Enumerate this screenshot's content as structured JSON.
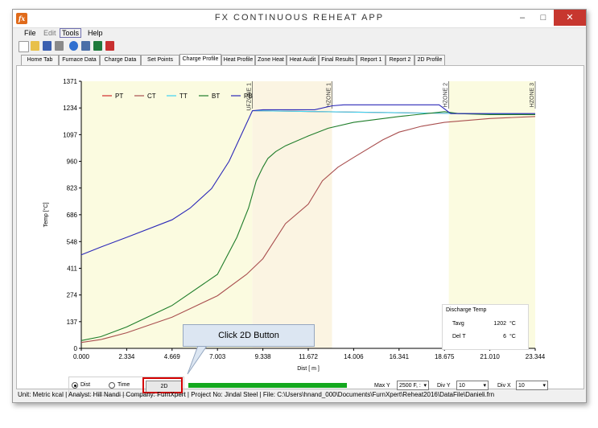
{
  "window": {
    "title": "FX CONTINUOUS REHEAT APP",
    "icon_label": "fx",
    "controls": {
      "minimize": "–",
      "maximize": "□",
      "close": "✕"
    }
  },
  "menu": [
    "File",
    "Edit",
    "Tools",
    "Help"
  ],
  "toolbar_icons": [
    "new-file-icon",
    "open-folder-icon",
    "save-icon",
    "print-icon",
    "help-icon",
    "report-icon",
    "excel-icon",
    "pdf-icon"
  ],
  "tabs": [
    "Home Tab",
    "Furnace Data",
    "Charge Data",
    "Set Points",
    "Charge Profile",
    "Heat Profile",
    "Zone Heat",
    "Heat Audit",
    "Final Results",
    "Report 1",
    "Report 2",
    "2D Profile"
  ],
  "active_tab": "Charge Profile",
  "chart_data": {
    "type": "line",
    "xlabel": "Dist [ m ]",
    "ylabel": "Temp [°C]",
    "x_ticks": [
      "0.000",
      "2.334",
      "4.669",
      "7.003",
      "9.338",
      "11.672",
      "14.006",
      "16.341",
      "18.675",
      "21.010",
      "23.344"
    ],
    "y_ticks": [
      "0",
      "137",
      "274",
      "411",
      "548",
      "686",
      "823",
      "960",
      "1097",
      "1234",
      "1371"
    ],
    "xlim": [
      0,
      23.344
    ],
    "ylim": [
      0,
      1371
    ],
    "grid": false,
    "legend_position": "top-left",
    "zones": [
      {
        "label": "UFZONE 1",
        "x_start": 0.0,
        "x_end": 8.8,
        "color": "#fbfbe0"
      },
      {
        "label": "HZONE 1",
        "x_start": 8.8,
        "x_end": 12.9,
        "color": "#fbf4e2"
      },
      {
        "label": "HZONE 2",
        "x_start": 12.9,
        "x_end": 18.9,
        "color": "#ffffff"
      },
      {
        "label": "HZONE 3",
        "x_start": 18.9,
        "x_end": 23.344,
        "color": "#fbfbe0"
      }
    ],
    "zone_label_x": [
      8.8,
      12.9,
      18.9,
      23.344
    ],
    "series": [
      {
        "name": "PT",
        "color": "#d22b2b",
        "x": [
          8.8,
          23.344
        ],
        "y": [
          1220,
          1200
        ]
      },
      {
        "name": "CT",
        "color": "#a94f4f",
        "x": [
          0,
          1,
          2.334,
          4.669,
          7.003,
          8.5,
          9.338,
          10.5,
          11.672,
          12.4,
          13.2,
          14.006,
          15.5,
          16.341,
          17.5,
          18.675,
          21.01,
          23.344
        ],
        "y": [
          30,
          45,
          80,
          160,
          270,
          380,
          460,
          640,
          740,
          860,
          930,
          980,
          1070,
          1110,
          1140,
          1160,
          1180,
          1190
        ]
      },
      {
        "name": "TT",
        "color": "#3ed2f0",
        "x": [
          8.8,
          23.344
        ],
        "y": [
          1220,
          1200
        ]
      },
      {
        "name": "BT",
        "color": "#1f7d2a",
        "x": [
          0,
          1,
          2.334,
          4.669,
          7.003,
          8.0,
          8.6,
          9.0,
          9.338,
          9.6,
          10.0,
          10.5,
          11.672,
          12.7,
          14.006,
          16.341,
          18.675,
          19.4,
          21.01,
          23.344
        ],
        "y": [
          40,
          60,
          110,
          220,
          380,
          570,
          720,
          860,
          930,
          975,
          1010,
          1040,
          1090,
          1130,
          1160,
          1190,
          1215,
          1205,
          1200,
          1200
        ]
      },
      {
        "name": "PB",
        "color": "#2b28b8",
        "x": [
          0,
          1,
          2.334,
          4.669,
          5.6,
          6.7,
          7.6,
          8.8,
          9.338,
          12.0,
          12.9,
          13.5,
          18.4,
          19.0,
          19.4,
          21.01,
          23.344
        ],
        "y": [
          480,
          520,
          570,
          660,
          720,
          820,
          960,
          1220,
          1225,
          1225,
          1245,
          1250,
          1250,
          1205,
          1205,
          1205,
          1205
        ]
      }
    ]
  },
  "discharge": {
    "title": "Discharge Temp",
    "tavg_label": "Tavg",
    "tavg_value": "1202",
    "tavg_unit": "°C",
    "delt_label": "Del T",
    "delt_value": "6",
    "delt_unit": "°C"
  },
  "callout_text": "Click 2D Button",
  "controls": {
    "radio_dist": "Dist",
    "radio_time": "Time",
    "button_2d": "2D",
    "max_y_label": "Max Y",
    "max_y_value": "2500 F, :",
    "div_y_label": "Div Y",
    "div_y_value": "10",
    "div_x_label": "Div X",
    "div_x_value": "10"
  },
  "status": "Unit:  Metric kcal   | Analyst: Hill Nandi   | Company: FurnXpert   | Project No: Jindal Steel   | File: C:\\Users\\hnand_000\\Documents\\FurnXpert\\Reheat2016\\DataFile\\Danieli.frn"
}
